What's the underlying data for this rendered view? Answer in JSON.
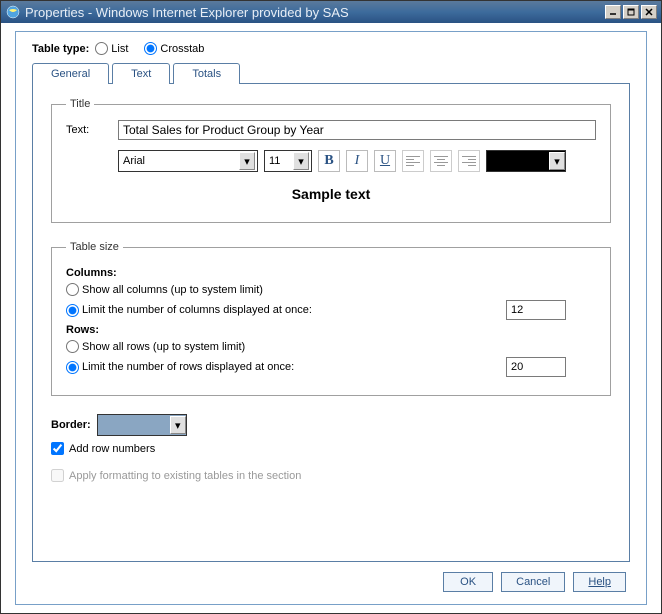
{
  "window": {
    "title": "Properties - Windows Internet Explorer provided by SAS"
  },
  "tableType": {
    "label": "Table type:",
    "options": {
      "list": "List",
      "crosstab": "Crosstab"
    },
    "selected": "crosstab"
  },
  "tabs": {
    "general": "General",
    "text": "Text",
    "totals": "Totals",
    "active": "general"
  },
  "titleGroup": {
    "legend": "Title",
    "textLabel": "Text:",
    "textValue": "Total Sales for Product Group by Year",
    "font": "Arial",
    "fontSize": "11",
    "sample": "Sample text"
  },
  "tableSize": {
    "legend": "Table size",
    "columnsLabel": "Columns:",
    "showAllCols": "Show all columns (up to system limit)",
    "limitCols": "Limit the number of columns displayed at once:",
    "colsValue": "12",
    "rowsLabel": "Rows:",
    "showAllRows": "Show all rows (up to system limit)",
    "limitRows": "Limit the number of rows displayed at once:",
    "rowsValue": "20"
  },
  "border": {
    "label": "Border:"
  },
  "addRowNumbers": "Add row numbers",
  "applyFormatting": "Apply formatting to existing tables in the section",
  "buttons": {
    "ok": "OK",
    "cancel": "Cancel",
    "help": "Help"
  }
}
